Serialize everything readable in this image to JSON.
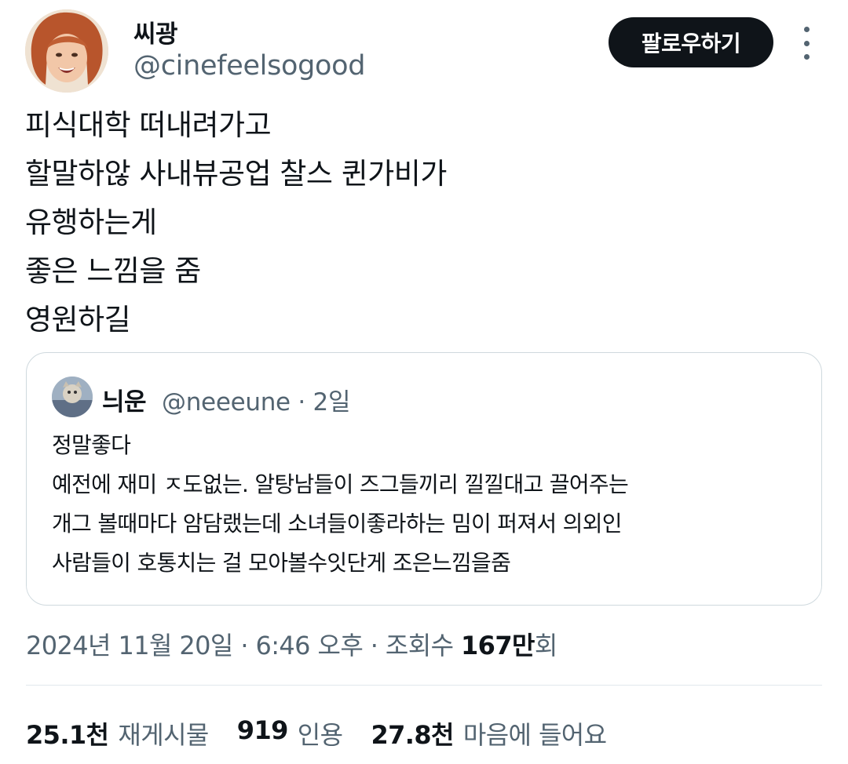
{
  "author": {
    "display_name": "씨광",
    "handle": "@cinefeelsogood"
  },
  "follow_button": "팔로우하기",
  "more_icon": "more-dots-icon",
  "tweet_lines": [
    "피식대학 떠내려가고",
    "할말하않 사내뷰공업 찰스 퀸가비가",
    "유행하는게",
    "좋은 느낌을 줌",
    "영원하길"
  ],
  "quote": {
    "display_name": "늬운",
    "handle": "@neeeune",
    "time": "2일",
    "lines": [
      "정말좋다",
      "예전에 재미 ㅈ도없는. 알탕남들이 즈그들끼리 낄낄대고 끌어주는",
      "개그 볼때마다 암담랬는데 소녀들이좋라하는 밈이 퍼져서 의외인",
      "사람들이 호통치는 걸 모아볼수잇단게 조은느낌을줌"
    ]
  },
  "meta": {
    "date": "2024년 11월 20일",
    "time": "6:46 오후",
    "views_label": "조회수",
    "views_num": "167만",
    "views_unit": "회"
  },
  "stats": [
    {
      "num": "25.1천",
      "label": "재게시물"
    },
    {
      "num": "919",
      "label": "인용"
    },
    {
      "num": "27.8천",
      "label": "마음에 들어요"
    }
  ]
}
